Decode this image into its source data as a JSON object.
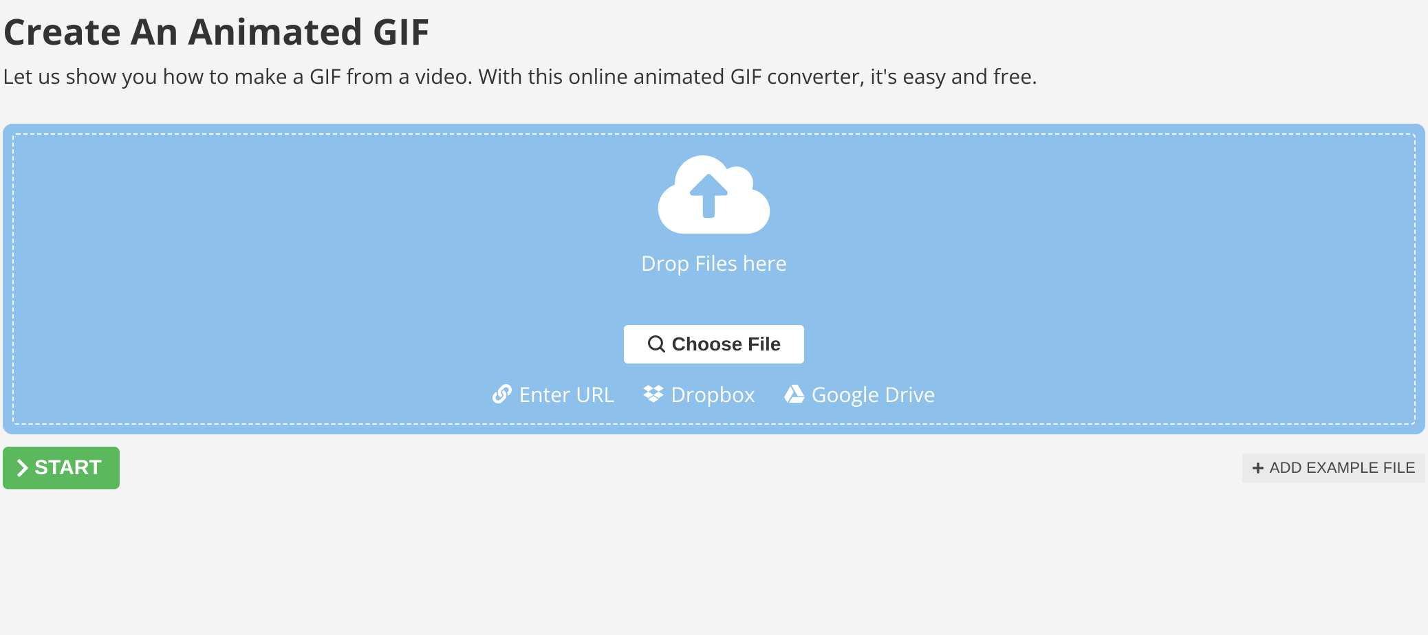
{
  "header": {
    "title": "Create An Animated GIF",
    "subtitle": "Let us show you how to make a GIF from a video. With this online animated GIF converter, it's easy and free."
  },
  "dropzone": {
    "drop_label": "Drop Files here",
    "choose_label": "Choose File",
    "sources": {
      "url": "Enter URL",
      "dropbox": "Dropbox",
      "gdrive": "Google Drive"
    }
  },
  "actions": {
    "start_label": "START",
    "example_label": "ADD EXAMPLE FILE"
  }
}
